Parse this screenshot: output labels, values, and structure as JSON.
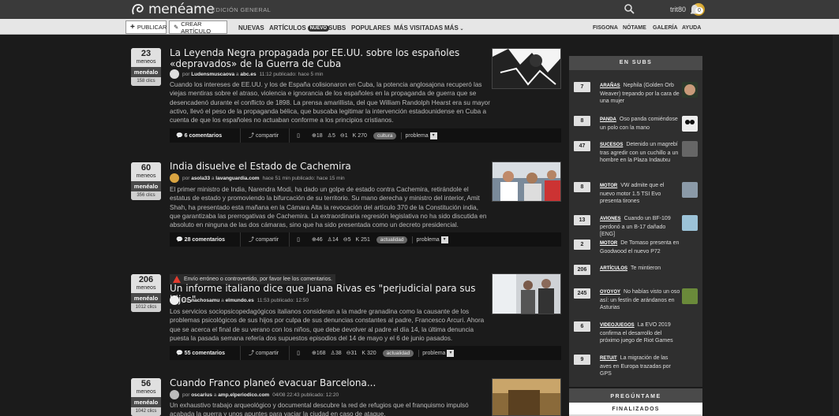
{
  "header": {
    "brand": "menéame",
    "edition": "EDICIÓN GENERAL",
    "user": "trit80",
    "notifications": "0"
  },
  "nav": {
    "publish": "PUBLICAR",
    "create": "CREAR ARTÍCULO",
    "items": [
      "NUEVAS",
      "ARTÍCULOS",
      "SUBS",
      "POPULARES",
      "MÁS VISITADAS",
      "MÁS"
    ],
    "new_badge": "nuevo",
    "right": [
      "FISGONA",
      "NÓTAME",
      "GALERÍA",
      "AYUDA"
    ]
  },
  "stories": [
    {
      "votes": "23",
      "votes_label": "meneos",
      "menealo": "menéalo",
      "clicks": "158 clics",
      "title": "La Leyenda Negra propagada por EE.UU. sobre los españoles «depravados» de la Guerra de Cuba",
      "author": "Ludensmuscaova",
      "domain": "abc.es",
      "time": "11:12 publicado: hace 5 min",
      "summary": "Cuando los intereses de EE.UU. y los de España colisionaron en Cuba, la potencia anglosajona recuperó las viejas mentiras sobre el atraso, violencia e ignorancia de los españoles en la propaganda de guerra que se desencadenó durante el conflicto de 1898. La prensa amarillista, del que William Randolph Hearst era su mayor activo, llevó el peso de la propaganda bélica, que buscaba legitimar la intervención estadounidense en Cuba a cuenta de que los españoles no actuaban conforme a los principios cristianos.",
      "comments": "6 comentarios",
      "share": "compartir",
      "s1": "18",
      "s2": "5",
      "s3": "1",
      "karma": "270",
      "tag": "cultura",
      "problem": "problema"
    },
    {
      "votes": "60",
      "votes_label": "meneos",
      "menealo": "menéalo",
      "clicks": "356 clics",
      "title": "India disuelve el Estado de Cachemira",
      "author": "asola33",
      "domain": "lavanguardia.com",
      "time": "hace 51 min publicado: hace 15 min",
      "summary": "El primer ministro de India, Narendra Modi, ha dado un golpe de estado contra Cachemira, retirándole el estatus de estado y promoviendo la bifurcación de su territorio. Su mano derecha y ministro del interior, Amit Shah, ha presentado esta mañana en la Cámara Alta la revocación del artículo 370 de la Constitución india, que garantizaba las prerrogativas de Cachemira. La extraordinaria regresión legislativa no ha sido discutida en absoluto en ninguna de las dos cámaras, sino que ha sido presentada como un decreto presidencial.",
      "comments": "28 comentarios",
      "share": "compartir",
      "s1": "46",
      "s2": "14",
      "s3": "5",
      "karma": "251",
      "tag": "actualidad",
      "problem": "problema"
    },
    {
      "votes": "206",
      "votes_label": "meneos",
      "menealo": "menéalo",
      "clicks": "1012 clics",
      "warning": "Envío erróneo o controvertido, por favor lee los comentarios.",
      "title": "Un informe italiano dice que Juana Rivas es \"perjudicial para sus hijos\"",
      "author": "nachosamu",
      "domain": "elmundo.es",
      "time": "11:53 publicado: 12:50",
      "summary": "Los servicios sociopsicopedagógicos italianos consideran a la madre granadina como la causante de los problemas psicológicos de sus hijos por culpa de sus denuncias constantes al padre, Francesco Arcuri. Ahora que se acerca el final de su verano con los niños, que debe devolver al padre el día 14, la última denuncia puesta la pasada semana refería dos supuestos episodios del 14 de mayo y el 6 de junio pasados.",
      "comments": "55 comentarios",
      "share": "compartir",
      "s1": "168",
      "s2": "38",
      "s3": "31",
      "karma": "320",
      "tag": "actualidad",
      "problem": "problema"
    },
    {
      "votes": "56",
      "votes_label": "meneos",
      "menealo": "menéalo",
      "clicks": "1042 clics",
      "title": "Cuando Franco planeó evacuar Barcelona...",
      "author": "oscarius",
      "domain": "amp.elperiodico.com",
      "time": "04/08 22:43 publicado: 12:20",
      "summary": "Un exhaustivo trabajo arqueológico y documental descubre la red de refugios que el franquismo impulsó acabada la guerra y unos apuntes para vaciar la ciudad en caso de ataque."
    }
  ],
  "sidebar": {
    "title": "EN SUBS",
    "items": [
      {
        "votes": "7",
        "sub": "ARAÑAS",
        "text": "Nephila (Golden Orb Weaver) trepando por la cara de una mujer"
      },
      {
        "votes": "8",
        "sub": "PANDA",
        "text": "Oso panda comiéndose un polo con la mano"
      },
      {
        "votes": "47",
        "sub": "SUCESOS",
        "text": "Detenido un magrebí tras agredir con un cuchillo a un hombre en la Plaza Indautxu"
      },
      {
        "votes": "8",
        "sub": "MOTOR",
        "text": "VW admite que el nuevo motor 1.5 TSI Evo presenta tirones"
      },
      {
        "votes": "13",
        "sub": "AVIONES",
        "text": "Cuando un BF-109 perdonó a un B-17 dañado [ENG]"
      },
      {
        "votes": "2",
        "sub": "MOTOR",
        "text": "De Tomaso presenta en Goodwood el nuevo P72"
      },
      {
        "votes": "206",
        "sub": "ARTÍCULOS",
        "text": "Te mintieron"
      },
      {
        "votes": "245",
        "sub": "OYOYOY",
        "text": "No habías visto un oso así: un festín de arándanos en Asturias"
      },
      {
        "votes": "6",
        "sub": "VIDEOJUEGOS",
        "text": "La EVO 2019 confirma el desarrollo del próximo juego de Riot Games"
      },
      {
        "votes": "9",
        "sub": "RETUIT",
        "text": "La migración de las aves en Europa trazadas por GPS"
      }
    ],
    "pregunta": "PREGÚNTAME",
    "finalizados": "FINALIZADOS"
  }
}
